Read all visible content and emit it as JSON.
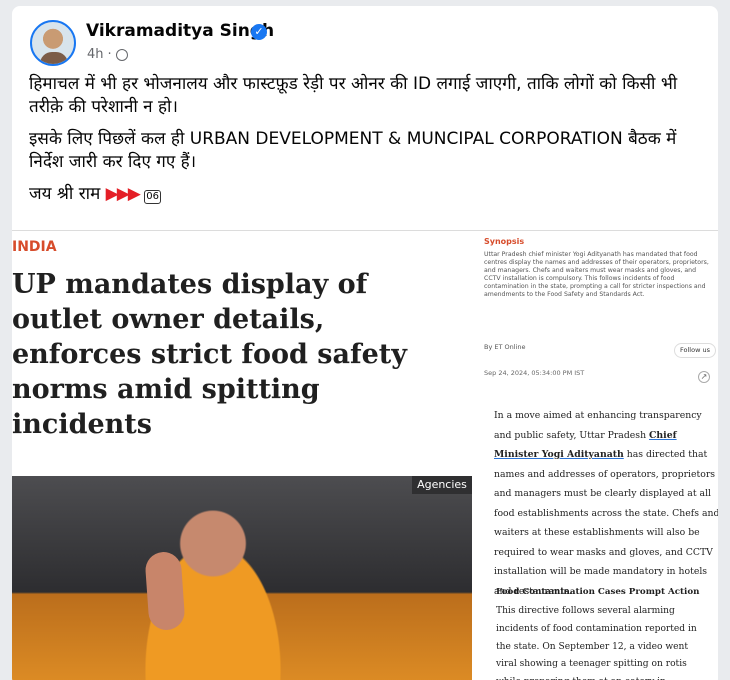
{
  "post": {
    "author": "Vikramaditya Singh",
    "timestamp": "4h",
    "text_line1": "हिमाचल में भी हर भोजनालय और फास्टफ़ूड रेड़ी पर ओनर की ID लगाई जाएगी, ताकि लोगों को किसी भी तरीक़े की परेशानी न हो।",
    "text_line2": "इसके लिए पिछलें कल ही URBAN DEVELOPMENT & MUNCIPAL CORPORATION बैठक में निर्देश जारी कर दिए गए हैं।",
    "text_line3": "जय श्री राम",
    "flags": "▶▶▶",
    "tag": "06"
  },
  "article": {
    "section": "INDIA",
    "headline": "UP mandates display of outlet owner details, enforces strict food safety norms amid spitting incidents",
    "photo_credit": "Agencies",
    "synopsis_title": "Synopsis",
    "synopsis": "Uttar Pradesh chief minister Yogi Adityanath has mandated that food centres display the names and addresses of their operators, proprietors, and managers. Chefs and waiters must wear masks and gloves, and CCTV installation is compulsory. This follows incidents of food contamination in the state, prompting a call for stricter inspections and amendments to the Food Safety and Standards Act.",
    "byline": "By ET Online",
    "follow": "Follow us",
    "date": "Sep 24, 2024, 05:34:00 PM IST",
    "body1_prefix": "In a move aimed at enhancing transparency and public safety, Uttar Pradesh ",
    "body1_link": "Chief Minister Yogi Adityanath",
    "body1_suffix": " has directed that names and addresses of operators, proprietors and managers must be clearly displayed at all food establishments across the state. Chefs and waiters at these establishments will also be required to wear masks and gloves, and CCTV installation will be made mandatory in hotels and restaurants.",
    "subhead": "Food Contamination Cases Prompt Action",
    "body2": "This directive follows several alarming incidents of food contamination reported in the state. On September 12, a video went viral showing a teenager spitting on rotis while preparing them at an eatery in Saharanpur"
  },
  "colors": {
    "facebook_blue": "#1877f2",
    "section_red": "#d74c2b",
    "flag_red": "#e41e26"
  }
}
